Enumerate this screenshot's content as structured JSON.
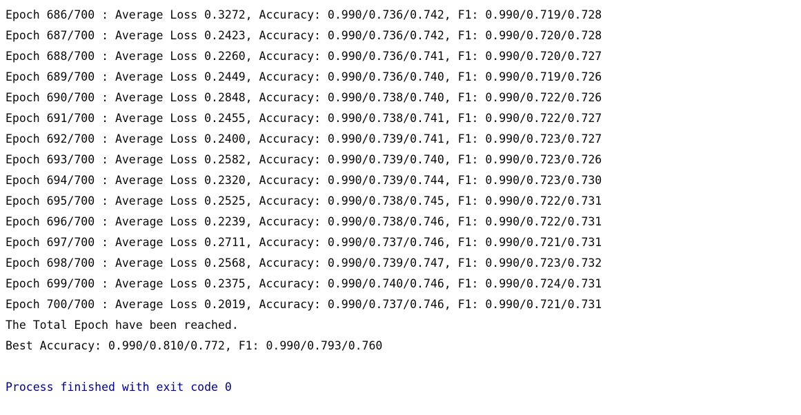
{
  "console": {
    "partial_top_fragments": [
      "'",
      "'",
      "'"
    ],
    "epoch_lines": [
      "Epoch 686/700 : Average Loss 0.3272, Accuracy: 0.990/0.736/0.742, F1: 0.990/0.719/0.728",
      "Epoch 687/700 : Average Loss 0.2423, Accuracy: 0.990/0.736/0.742, F1: 0.990/0.720/0.728",
      "Epoch 688/700 : Average Loss 0.2260, Accuracy: 0.990/0.736/0.741, F1: 0.990/0.720/0.727",
      "Epoch 689/700 : Average Loss 0.2449, Accuracy: 0.990/0.736/0.740, F1: 0.990/0.719/0.726",
      "Epoch 690/700 : Average Loss 0.2848, Accuracy: 0.990/0.738/0.740, F1: 0.990/0.722/0.726",
      "Epoch 691/700 : Average Loss 0.2455, Accuracy: 0.990/0.738/0.741, F1: 0.990/0.722/0.727",
      "Epoch 692/700 : Average Loss 0.2400, Accuracy: 0.990/0.739/0.741, F1: 0.990/0.723/0.727",
      "Epoch 693/700 : Average Loss 0.2582, Accuracy: 0.990/0.739/0.740, F1: 0.990/0.723/0.726",
      "Epoch 694/700 : Average Loss 0.2320, Accuracy: 0.990/0.739/0.744, F1: 0.990/0.723/0.730",
      "Epoch 695/700 : Average Loss 0.2525, Accuracy: 0.990/0.738/0.745, F1: 0.990/0.722/0.731",
      "Epoch 696/700 : Average Loss 0.2239, Accuracy: 0.990/0.738/0.746, F1: 0.990/0.722/0.731",
      "Epoch 697/700 : Average Loss 0.2711, Accuracy: 0.990/0.737/0.746, F1: 0.990/0.721/0.731",
      "Epoch 698/700 : Average Loss 0.2568, Accuracy: 0.990/0.739/0.747, F1: 0.990/0.723/0.732",
      "Epoch 699/700 : Average Loss 0.2375, Accuracy: 0.990/0.740/0.746, F1: 0.990/0.724/0.731",
      "Epoch 700/700 : Average Loss 0.2019, Accuracy: 0.990/0.737/0.746, F1: 0.990/0.721/0.731"
    ],
    "total_epoch_message": "The Total Epoch have been reached.",
    "best_accuracy_line": "Best Accuracy: 0.990/0.810/0.772, F1: 0.990/0.793/0.760",
    "process_finished": "Process finished with exit code 0"
  },
  "colors": {
    "background": "#ffffff",
    "text": "#080808",
    "process_text": "#000080"
  }
}
